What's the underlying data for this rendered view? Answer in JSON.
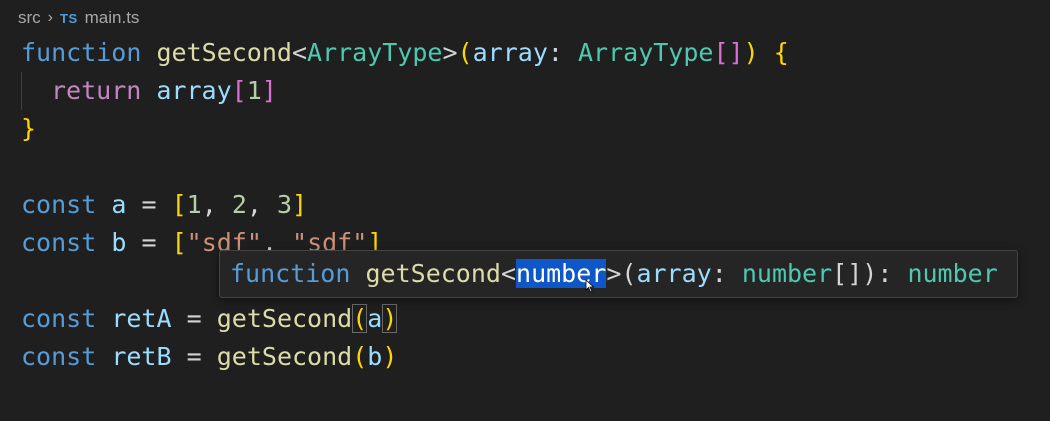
{
  "breadcrumb": {
    "folder": "src",
    "file_icon": "TS",
    "file_name": "main.ts",
    "chevron_icon": "chevron-right-icon"
  },
  "code": {
    "line1": {
      "kw": "function",
      "name": "getSecond",
      "lt": "<",
      "type_param": "ArrayType",
      "gt": ">",
      "lparen": "(",
      "param": "array",
      "colon": ":",
      "param_type": "ArrayType",
      "arr_brackets": "[]",
      "rparen": ")",
      "lbrace": "{"
    },
    "line2": {
      "kw": "return",
      "var": "array",
      "lbr": "[",
      "index": "1",
      "rbr": "]"
    },
    "line3": {
      "rbrace": "}"
    },
    "line5": {
      "kw": "const",
      "name": "a",
      "eq": "=",
      "lbr": "[",
      "v1": "1",
      "v2": "2",
      "v3": "3",
      "rbr": "]"
    },
    "line6": {
      "kw": "const",
      "name": "b",
      "eq": "=",
      "lbr": "[",
      "s1": "\"sdf\"",
      "s2": "\"sdf\"",
      "rbr": "]"
    },
    "line8": {
      "kw": "const",
      "name": "retA",
      "eq": "=",
      "fn": "getSecond",
      "lparen": "(",
      "arg": "a",
      "rparen": ")"
    },
    "line9": {
      "kw": "const",
      "name": "retB",
      "eq": "=",
      "fn": "getSecond",
      "lparen": "(",
      "arg": "b",
      "rparen": ")"
    }
  },
  "hover": {
    "kw": "function",
    "name": "getSecond",
    "lt": "<",
    "type_arg": "number",
    "gt": ">",
    "lparen": "(",
    "param": "array",
    "colon": ":",
    "param_type": "number",
    "arr": "[]",
    "rparen": ")",
    "colon2": ":",
    "return_type": "number"
  },
  "colors": {
    "background": "#1f1f1f",
    "keyword": "#569cd6",
    "function": "#dcdcaa",
    "type": "#4ec9b0",
    "variable": "#9cdcfe",
    "selection": "#0e57c8"
  }
}
